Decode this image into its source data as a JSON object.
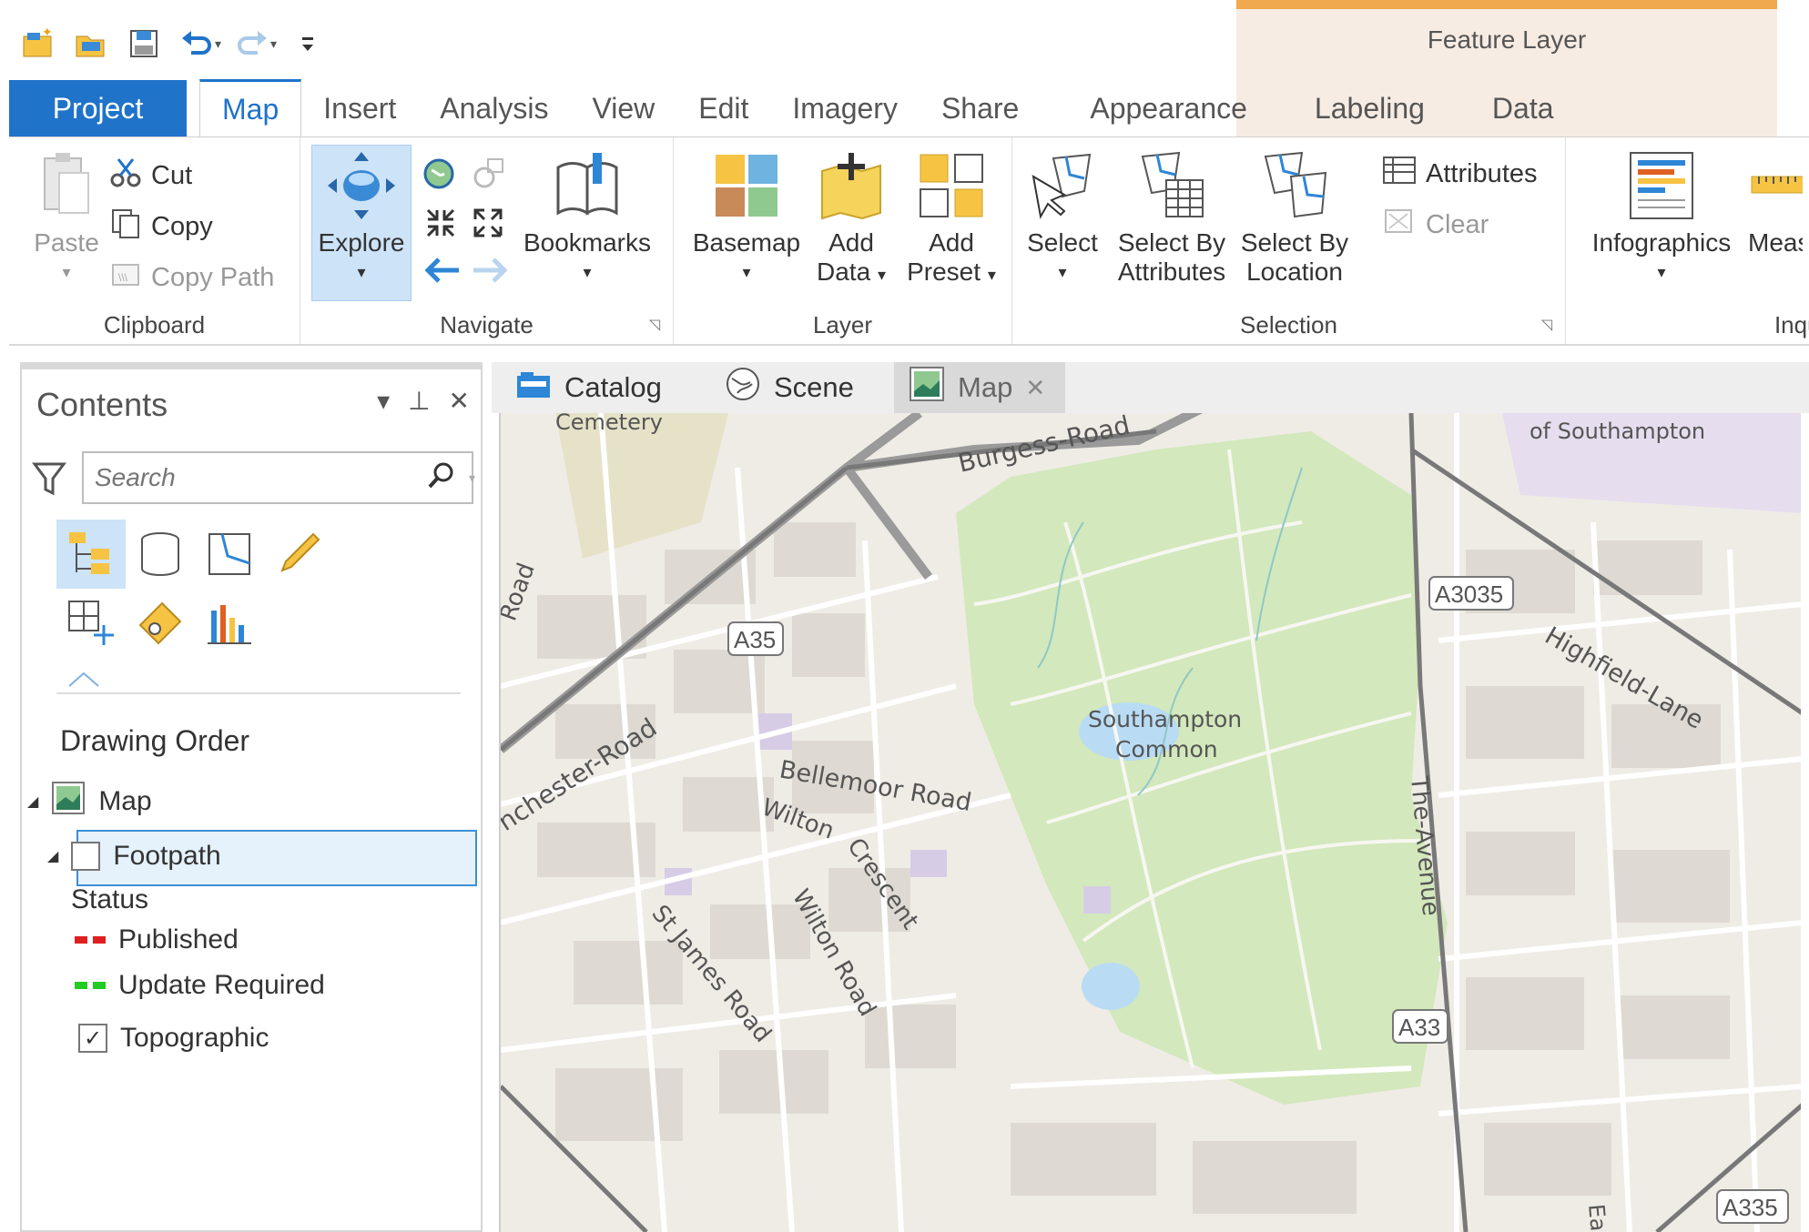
{
  "contextual": {
    "title": "Feature Layer"
  },
  "tabs": [
    "Project",
    "Map",
    "Insert",
    "Analysis",
    "View",
    "Edit",
    "Imagery",
    "Share",
    "Appearance",
    "Labeling",
    "Data"
  ],
  "ribbon": {
    "clipboard": {
      "label": "Clipboard",
      "paste": "Paste",
      "cut": "Cut",
      "copy": "Copy",
      "copy_path": "Copy Path"
    },
    "navigate": {
      "label": "Navigate",
      "explore": "Explore",
      "bookmarks": "Bookmarks"
    },
    "layer": {
      "label": "Layer",
      "basemap": "Basemap",
      "add_data_1": "Add",
      "add_data_2": "Data",
      "add_preset_1": "Add",
      "add_preset_2": "Preset"
    },
    "selection": {
      "label": "Selection",
      "select": "Select",
      "by_attr_1": "Select By",
      "by_attr_2": "Attributes",
      "by_loc_1": "Select By",
      "by_loc_2": "Location",
      "attributes": "Attributes",
      "clear": "Clear"
    },
    "inquiry": {
      "label": "Inquiry",
      "infographics": "Infographics",
      "measure": "Measure"
    }
  },
  "contents": {
    "title": "Contents",
    "search_placeholder": "Search",
    "drawing_order": "Drawing Order",
    "map_item": "Map",
    "footpath": "Footpath",
    "status": "Status",
    "published": "Published",
    "update_required": "Update Required",
    "topographic": "Topographic"
  },
  "view_tabs": {
    "catalog": "Catalog",
    "scene": "Scene",
    "map": "Map"
  },
  "map_labels": {
    "cemetery": "Cemetery",
    "burgess": "Burgess-Road",
    "univ": "of Southampton",
    "road_left": "Road",
    "a35": "A35",
    "a3035": "A3035",
    "highfield": "Highfield-Lane",
    "winchester": "nchester-Road",
    "common_1": "Southampton",
    "common_2": "Common",
    "bellemoor": "Bellemoor Road",
    "wilton": "Wilton",
    "crescent": "Crescent",
    "wilton_road": "Wilton Road",
    "st_james": "St James Road",
    "avenue": "The-Avenue",
    "a33": "A33",
    "earls": "Earls",
    "a335": "A335"
  },
  "colors": {
    "accent": "#1f73c9",
    "context": "#f0a94e",
    "published": "#e02020",
    "update_required": "#22cc22",
    "park": "#d3e8bc"
  }
}
